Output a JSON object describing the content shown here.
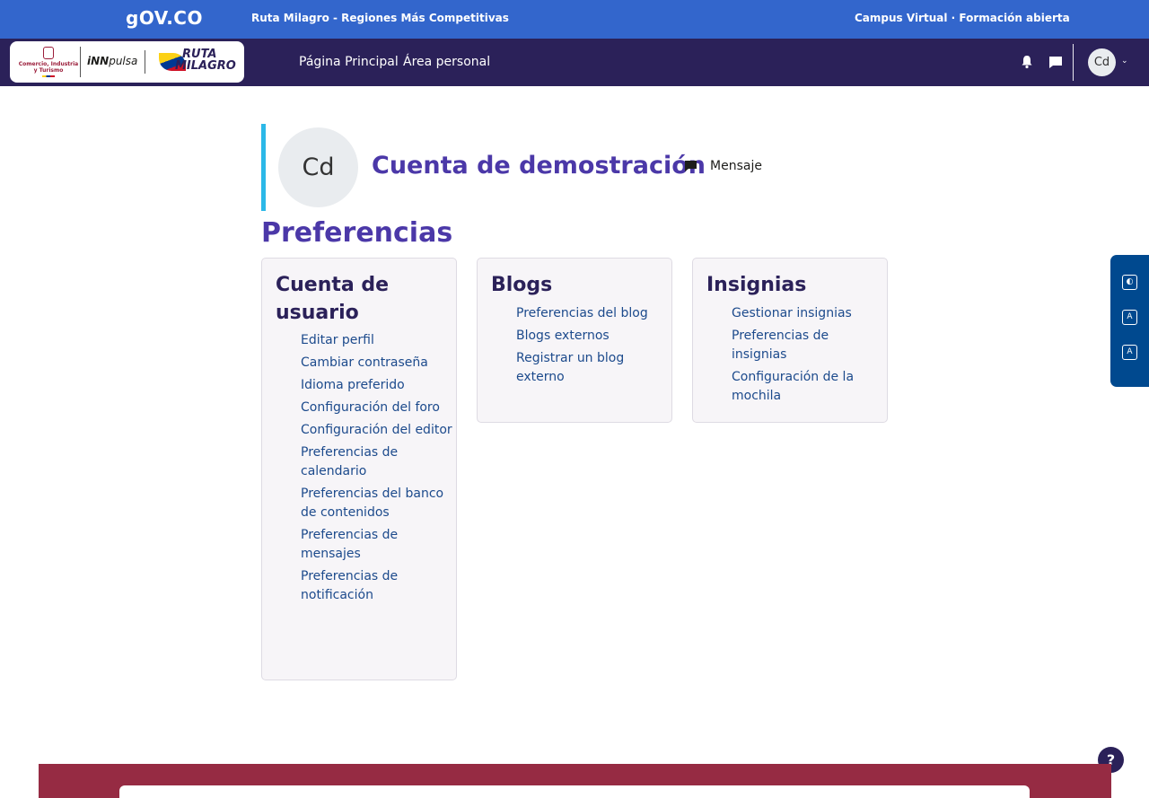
{
  "gov_bar": {
    "logo": "gov.co",
    "logo_text": "OV.CO",
    "center_title": "Ruta Milagro - Regiones Más Competitivas",
    "right_title": "Campus Virtual · Formación abierta",
    "color": "#3366cc"
  },
  "navbar": {
    "color": "#2b2159",
    "logos": {
      "mincit": "Comercio, Industria y Turismo",
      "innpulsa_inn": "iNN",
      "innpulsa_pulsa": "pulsa",
      "ruta_line1": "RUTA",
      "ruta_line2": "MILAGRO"
    },
    "links": [
      "Página Principal",
      "Área personal"
    ],
    "user_initials": "Cd",
    "icons": [
      "bell-icon",
      "chat-icon",
      "chevron-down-icon"
    ]
  },
  "profile": {
    "initials": "Cd",
    "name": "Cuenta de demostración",
    "message_label": "Mensaje",
    "accent_color": "#2bb8e8"
  },
  "page_title": "Preferencias",
  "cards": {
    "user": {
      "title": "Cuenta de usuario",
      "links": [
        "Editar perfil",
        "Cambiar contraseña",
        "Idioma preferido",
        "Configuración del foro",
        "Configuración del editor",
        "Preferencias de calendario",
        "Preferencias del banco de contenidos",
        "Preferencias de mensajes",
        "Preferencias de notificación"
      ]
    },
    "blogs": {
      "title": "Blogs",
      "links": [
        "Preferencias del blog",
        "Blogs externos",
        "Registrar un blog externo"
      ]
    },
    "badges": {
      "title": "Insignias",
      "links": [
        "Gestionar insignias",
        "Preferencias de insignias",
        "Configuración de la mochila"
      ]
    }
  },
  "accessibility": {
    "color": "#00498f",
    "buttons": [
      "contrast-icon",
      "font-decrease-icon",
      "font-increase-icon"
    ],
    "labels": [
      "◐",
      "A",
      "A"
    ]
  },
  "help_label": "?",
  "footer_color": "#962b43"
}
